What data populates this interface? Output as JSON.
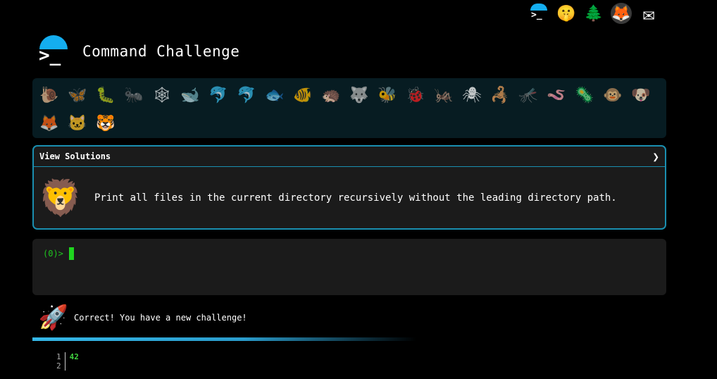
{
  "topbar": {
    "icons": [
      {
        "name": "terminal-logo-icon",
        "glyph": ">_"
      },
      {
        "name": "shush-face-icon",
        "glyph": "🤫"
      },
      {
        "name": "tree-icon",
        "glyph": "🌲"
      },
      {
        "name": "gitlab-icon",
        "glyph": "🦊"
      },
      {
        "name": "mail-icon",
        "glyph": "✉"
      }
    ]
  },
  "header": {
    "logo_glyph": ">_",
    "title": "Command Challenge"
  },
  "animals": [
    "🐌",
    "🦋",
    "🐛",
    "🐜",
    "🕸",
    "🐋",
    "🐬",
    "🐬",
    "🐟",
    "🐠",
    "🦔",
    "🐺",
    "🐝",
    "🐞",
    "🦗",
    "🕷",
    "🦂",
    "🦟",
    "🪱",
    "🦠",
    "🐵",
    "🐶",
    "🦊",
    "🐱",
    "🐯"
  ],
  "animals_active_index": 24,
  "challenge": {
    "header_label": "View Solutions",
    "chevron": "❯",
    "avatar": "🦁",
    "text": "Print all files in the current directory recursively without the leading directory path."
  },
  "terminal": {
    "prompt": "(0)>"
  },
  "status": {
    "icon": "🚀",
    "text": "Correct! You have a new challenge!"
  },
  "output": {
    "line_numbers": [
      "1",
      "2"
    ],
    "lines": [
      "42",
      ""
    ]
  },
  "colors": {
    "accent": "#14aef0",
    "prompt": "#1fc41f",
    "panel": "#1b1b1b"
  }
}
